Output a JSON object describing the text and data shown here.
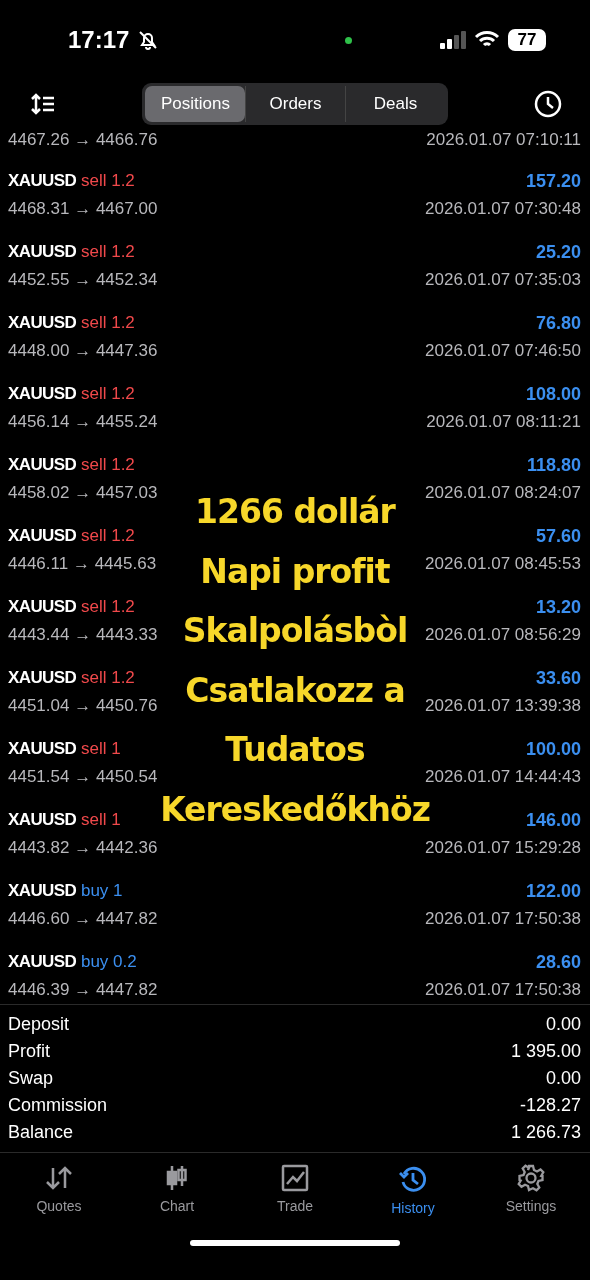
{
  "status_bar": {
    "time": "17:17",
    "battery": "77"
  },
  "tabs": [
    {
      "label": "Positions",
      "selected": true
    },
    {
      "label": "Orders",
      "selected": false
    },
    {
      "label": "Deals",
      "selected": false
    }
  ],
  "partial_row": {
    "prices": "4467.26 → 4466.76",
    "time": "2026.01.07 07:10:11"
  },
  "deals": [
    {
      "symbol": "XAUUSD",
      "kind": "sell",
      "side": "sell",
      "volume": "1.2",
      "profit": "157.20",
      "prices": "4468.31 → 4467.00",
      "time": "2026.01.07 07:30:48"
    },
    {
      "symbol": "XAUUSD",
      "kind": "sell",
      "side": "sell",
      "volume": "1.2",
      "profit": "25.20",
      "prices": "4452.55 → 4452.34",
      "time": "2026.01.07 07:35:03"
    },
    {
      "symbol": "XAUUSD",
      "kind": "sell",
      "side": "sell",
      "volume": "1.2",
      "profit": "76.80",
      "prices": "4448.00 → 4447.36",
      "time": "2026.01.07 07:46:50"
    },
    {
      "symbol": "XAUUSD",
      "kind": "sell",
      "side": "sell",
      "volume": "1.2",
      "profit": "108.00",
      "prices": "4456.14 → 4455.24",
      "time": "2026.01.07 08:11:21"
    },
    {
      "symbol": "XAUUSD",
      "kind": "sell",
      "side": "sell",
      "volume": "1.2",
      "profit": "118.80",
      "prices": "4458.02 → 4457.03",
      "time": "2026.01.07 08:24:07"
    },
    {
      "symbol": "XAUUSD",
      "kind": "sell",
      "side": "sell",
      "volume": "1.2",
      "profit": "57.60",
      "prices": "4446.11 → 4445.63",
      "time": "2026.01.07 08:45:53"
    },
    {
      "symbol": "XAUUSD",
      "kind": "sell",
      "side": "sell",
      "volume": "1.2",
      "profit": "13.20",
      "prices": "4443.44 → 4443.33",
      "time": "2026.01.07 08:56:29"
    },
    {
      "symbol": "XAUUSD",
      "kind": "sell",
      "side": "sell",
      "volume": "1.2",
      "profit": "33.60",
      "prices": "4451.04 → 4450.76",
      "time": "2026.01.07 13:39:38"
    },
    {
      "symbol": "XAUUSD",
      "kind": "sell",
      "side": "sell",
      "volume": "1",
      "profit": "100.00",
      "prices": "4451.54 → 4450.54",
      "time": "2026.01.07 14:44:43"
    },
    {
      "symbol": "XAUUSD",
      "kind": "sell",
      "side": "sell",
      "volume": "1",
      "profit": "146.00",
      "prices": "4443.82 → 4442.36",
      "time": "2026.01.07 15:29:28"
    },
    {
      "symbol": "XAUUSD",
      "kind": "buy",
      "side": "buy",
      "volume": "1",
      "profit": "122.00",
      "prices": "4446.60 → 4447.82",
      "time": "2026.01.07 17:50:38"
    },
    {
      "symbol": "XAUUSD",
      "kind": "buy",
      "side": "buy",
      "volume": "0.2",
      "profit": "28.60",
      "prices": "4446.39 → 4447.82",
      "time": "2026.01.07 17:50:38"
    }
  ],
  "summary": [
    {
      "label": "Deposit",
      "value": "0.00"
    },
    {
      "label": "Profit",
      "value": "1 395.00"
    },
    {
      "label": "Swap",
      "value": "0.00"
    },
    {
      "label": "Commission",
      "value": "-128.27"
    },
    {
      "label": "Balance",
      "value": "1 266.73"
    }
  ],
  "overlay_text": [
    "1266 dollár",
    "Napi profit",
    "Skalpolásbòl",
    "Csatlakozz a",
    "Tudatos",
    "Kereskedőkhöz"
  ],
  "nav": [
    {
      "label": "Quotes",
      "kind": "quotes",
      "selected": false
    },
    {
      "label": "Chart",
      "kind": "chart",
      "selected": false
    },
    {
      "label": "Trade",
      "kind": "trade",
      "selected": false
    },
    {
      "label": "History",
      "kind": "history",
      "selected": true
    },
    {
      "label": "Settings",
      "kind": "settings",
      "selected": false
    }
  ]
}
